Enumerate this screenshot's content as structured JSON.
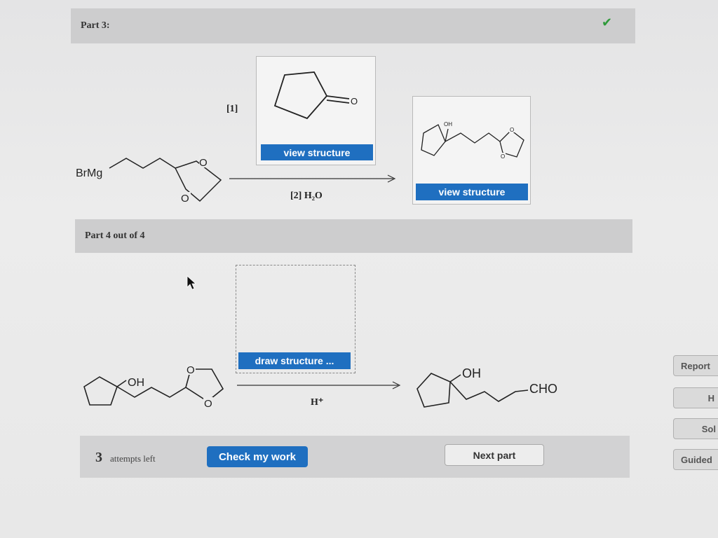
{
  "part3": {
    "title": "Part 3:",
    "check_icon": "checkmark-icon"
  },
  "reaction1": {
    "reactant_label": "BrMg",
    "reactant_o_top": "O",
    "reactant_o_bottom": "O",
    "step1_label": "[1]",
    "step2_label": "[2] H₂O",
    "reagent_ketone_o": "O",
    "reagent_button": "view structure",
    "product_oh": "OH",
    "product_o_top": "O",
    "product_o_bottom": "O",
    "product_button": "view structure"
  },
  "part4": {
    "title": "Part 4 out of 4"
  },
  "reaction2": {
    "draw_button": "draw structure ...",
    "reactant_oh": "OH",
    "reactant_o_top": "O",
    "reactant_o_bottom": "O",
    "reagent_label": "H⁺",
    "product_oh": "OH",
    "product_cho": "CHO"
  },
  "footer": {
    "attempts_count": "3",
    "attempts_text": "attempts left",
    "check_button": "Check my work",
    "next_button": "Next part"
  },
  "side_panel": {
    "report": "Report",
    "h": "H",
    "sol": "Sol",
    "guided": "Guided"
  },
  "colors": {
    "accent_blue": "#1f6fc0",
    "check_green": "#2f9a3a"
  }
}
